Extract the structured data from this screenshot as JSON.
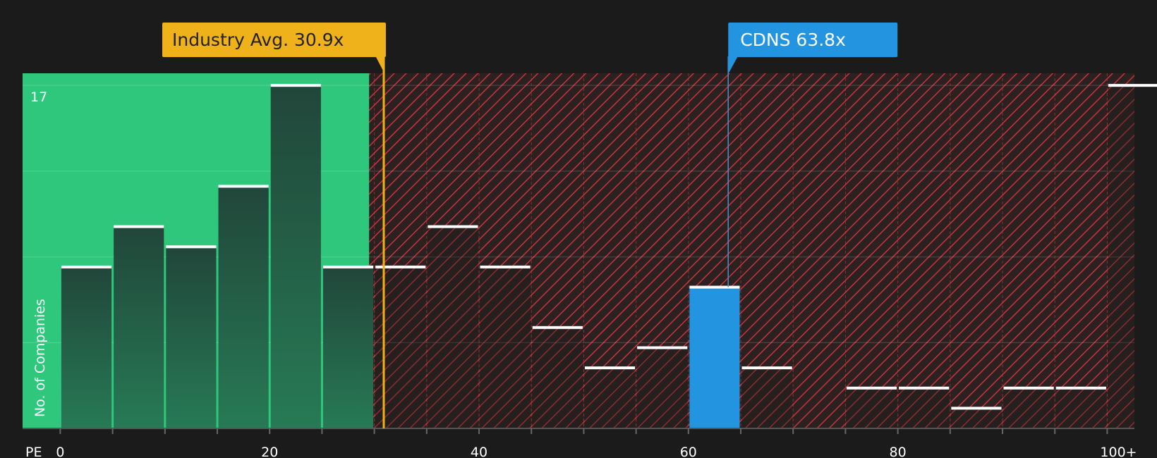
{
  "chart_data": {
    "type": "bar",
    "ylabel": "No. of Companies",
    "xlabel": "PE",
    "y_max_label": "17",
    "ylim": [
      0,
      17.6
    ],
    "xlim": [
      -3.6,
      102.6
    ],
    "x_ticks": [
      {
        "value": 0,
        "label": "0"
      },
      {
        "value": 20,
        "label": "20"
      },
      {
        "value": 40,
        "label": "40"
      },
      {
        "value": 60,
        "label": "60"
      },
      {
        "value": 80,
        "label": "80"
      },
      {
        "value": 100,
        "label": "100+"
      }
    ],
    "bin_width": 5,
    "bins": [
      {
        "start": 0,
        "end": 5,
        "count": 8
      },
      {
        "start": 5,
        "end": 10,
        "count": 10
      },
      {
        "start": 10,
        "end": 15,
        "count": 9
      },
      {
        "start": 15,
        "end": 20,
        "count": 12
      },
      {
        "start": 20,
        "end": 25,
        "count": 17
      },
      {
        "start": 25,
        "end": 30,
        "count": 8
      },
      {
        "start": 30,
        "end": 35,
        "count": 8
      },
      {
        "start": 35,
        "end": 40,
        "count": 10
      },
      {
        "start": 40,
        "end": 45,
        "count": 8
      },
      {
        "start": 45,
        "end": 50,
        "count": 5
      },
      {
        "start": 50,
        "end": 55,
        "count": 3
      },
      {
        "start": 55,
        "end": 60,
        "count": 4
      },
      {
        "start": 60,
        "end": 65,
        "count": 7,
        "highlight": true
      },
      {
        "start": 65,
        "end": 70,
        "count": 3
      },
      {
        "start": 70,
        "end": 75,
        "count": 0
      },
      {
        "start": 75,
        "end": 80,
        "count": 2
      },
      {
        "start": 80,
        "end": 85,
        "count": 2
      },
      {
        "start": 85,
        "end": 90,
        "count": 1
      },
      {
        "start": 90,
        "end": 95,
        "count": 2
      },
      {
        "start": 95,
        "end": 100,
        "count": 2
      },
      {
        "start": 100,
        "end": 105,
        "count": 17
      }
    ],
    "industry_avg": {
      "value": 30.9,
      "label": "Industry Avg. 30.9x"
    },
    "company": {
      "value": 63.8,
      "label": "CDNS 63.8x"
    },
    "fair_zone_end": 29.5
  },
  "colors": {
    "background": "#1b1b1b",
    "fair_zone": "#2ec77c",
    "fair_bar_top": "#21463a",
    "fair_bar_bottom": "#277a55",
    "over_zone": "#2a2120",
    "hatch": "#c7353c",
    "highlight_bar": "#2394e0",
    "industry_callout": "#f0b21a",
    "company_callout": "#2394e0",
    "company_line": "#4a8fc9"
  }
}
